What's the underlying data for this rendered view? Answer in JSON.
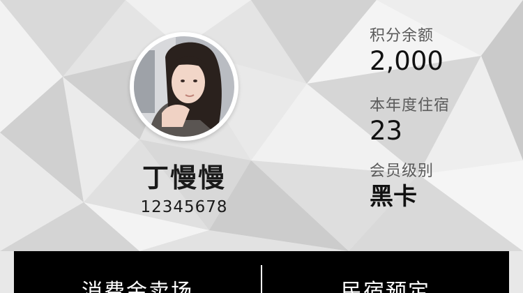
{
  "profile": {
    "name": "丁慢慢",
    "member_id": "12345678"
  },
  "stats": {
    "points_label": "积分余额",
    "points_value": "2,000",
    "stays_label": "本年度住宿",
    "stays_value": "23",
    "level_label": "会员级别",
    "level_value": "黑卡"
  },
  "actions": {
    "left_label": "消费金卖场",
    "right_label": "民宿预定"
  },
  "colors": {
    "action_bar": "#000000",
    "text_primary": "#111111",
    "background": "#e6e6e6"
  }
}
